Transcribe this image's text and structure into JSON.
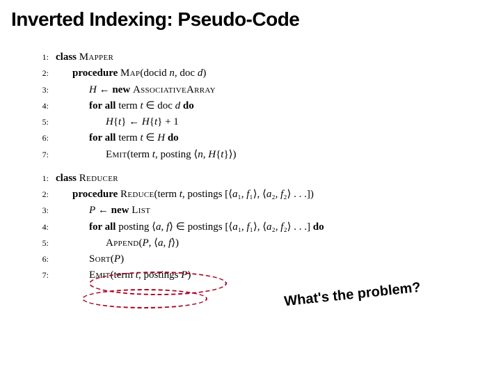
{
  "title": "Inverted Indexing: Pseudo-Code",
  "annotation": "What's the problem?",
  "mapper": {
    "lines": [
      {
        "n": "1:",
        "indent": 0,
        "parts": [
          {
            "t": "class ",
            "c": "kw"
          },
          {
            "t": "Mapper",
            "c": "sc"
          }
        ]
      },
      {
        "n": "2:",
        "indent": 1,
        "parts": [
          {
            "t": "procedure ",
            "c": "kw"
          },
          {
            "t": "Map",
            "c": "sc"
          },
          {
            "t": "(docid "
          },
          {
            "t": "n",
            "c": "it"
          },
          {
            "t": ", doc "
          },
          {
            "t": "d",
            "c": "it"
          },
          {
            "t": ")"
          }
        ]
      },
      {
        "n": "3:",
        "indent": 2,
        "parts": [
          {
            "t": "H",
            "c": "it"
          },
          {
            "t": " ← "
          },
          {
            "t": "new ",
            "c": "kw"
          },
          {
            "t": "AssociativeArray",
            "c": "sc"
          }
        ]
      },
      {
        "n": "4:",
        "indent": 2,
        "parts": [
          {
            "t": "for all ",
            "c": "kw"
          },
          {
            "t": "term "
          },
          {
            "t": "t",
            "c": "it"
          },
          {
            "t": " ∈ doc "
          },
          {
            "t": "d",
            "c": "it"
          },
          {
            "t": " do",
            "c": "kw"
          }
        ]
      },
      {
        "n": "5:",
        "indent": 3,
        "parts": [
          {
            "t": "H",
            "c": "it"
          },
          {
            "t": "{"
          },
          {
            "t": "t",
            "c": "it"
          },
          {
            "t": "} ← "
          },
          {
            "t": "H",
            "c": "it"
          },
          {
            "t": "{"
          },
          {
            "t": "t",
            "c": "it"
          },
          {
            "t": "} + 1"
          }
        ]
      },
      {
        "n": "6:",
        "indent": 2,
        "parts": [
          {
            "t": "for all ",
            "c": "kw"
          },
          {
            "t": "term "
          },
          {
            "t": "t",
            "c": "it"
          },
          {
            "t": " ∈ "
          },
          {
            "t": "H",
            "c": "it"
          },
          {
            "t": " do",
            "c": "kw"
          }
        ]
      },
      {
        "n": "7:",
        "indent": 3,
        "parts": [
          {
            "t": "Emit",
            "c": "sc"
          },
          {
            "t": "(term "
          },
          {
            "t": "t",
            "c": "it"
          },
          {
            "t": ", posting ⟨"
          },
          {
            "t": "n",
            "c": "it"
          },
          {
            "t": ", "
          },
          {
            "t": "H",
            "c": "it"
          },
          {
            "t": "{"
          },
          {
            "t": "t",
            "c": "it"
          },
          {
            "t": "}⟩)"
          }
        ]
      }
    ]
  },
  "reducer": {
    "lines": [
      {
        "n": "1:",
        "indent": 0,
        "parts": [
          {
            "t": "class ",
            "c": "kw"
          },
          {
            "t": "Reducer",
            "c": "sc"
          }
        ]
      },
      {
        "n": "2:",
        "indent": 1,
        "parts": [
          {
            "t": "procedure ",
            "c": "kw"
          },
          {
            "t": "Reduce",
            "c": "sc"
          },
          {
            "t": "(term "
          },
          {
            "t": "t",
            "c": "it"
          },
          {
            "t": ", postings [⟨"
          },
          {
            "t": "a",
            "c": "it"
          },
          {
            "t": "₁, "
          },
          {
            "t": "f",
            "c": "it"
          },
          {
            "t": "₁⟩, ⟨"
          },
          {
            "t": "a",
            "c": "it"
          },
          {
            "t": "₂, "
          },
          {
            "t": "f",
            "c": "it"
          },
          {
            "t": "₂⟩ . . .])"
          }
        ]
      },
      {
        "n": "3:",
        "indent": 2,
        "parts": [
          {
            "t": "P",
            "c": "it"
          },
          {
            "t": " ← "
          },
          {
            "t": "new ",
            "c": "kw"
          },
          {
            "t": "List",
            "c": "sc"
          }
        ]
      },
      {
        "n": "4:",
        "indent": 2,
        "parts": [
          {
            "t": "for all ",
            "c": "kw"
          },
          {
            "t": "posting ⟨"
          },
          {
            "t": "a",
            "c": "it"
          },
          {
            "t": ", "
          },
          {
            "t": "f",
            "c": "it"
          },
          {
            "t": "⟩ ∈ postings [⟨"
          },
          {
            "t": "a",
            "c": "it"
          },
          {
            "t": "₁, "
          },
          {
            "t": "f",
            "c": "it"
          },
          {
            "t": "₁⟩, ⟨"
          },
          {
            "t": "a",
            "c": "it"
          },
          {
            "t": "₂, "
          },
          {
            "t": "f",
            "c": "it"
          },
          {
            "t": "₂⟩ . . .] "
          },
          {
            "t": "do",
            "c": "kw"
          }
        ]
      },
      {
        "n": "5:",
        "indent": 3,
        "parts": [
          {
            "t": "Append",
            "c": "sc"
          },
          {
            "t": "("
          },
          {
            "t": "P",
            "c": "it"
          },
          {
            "t": ", ⟨"
          },
          {
            "t": "a",
            "c": "it"
          },
          {
            "t": ", "
          },
          {
            "t": "f",
            "c": "it"
          },
          {
            "t": "⟩)"
          }
        ]
      },
      {
        "n": "6:",
        "indent": 2,
        "parts": [
          {
            "t": "Sort",
            "c": "sc"
          },
          {
            "t": "("
          },
          {
            "t": "P",
            "c": "it"
          },
          {
            "t": ")"
          }
        ]
      },
      {
        "n": "7:",
        "indent": 2,
        "parts": [
          {
            "t": "Emit",
            "c": "sc"
          },
          {
            "t": "(term "
          },
          {
            "t": "t",
            "c": "it"
          },
          {
            "t": ", postings "
          },
          {
            "t": "P",
            "c": "it"
          },
          {
            "t": ")"
          }
        ]
      }
    ]
  }
}
